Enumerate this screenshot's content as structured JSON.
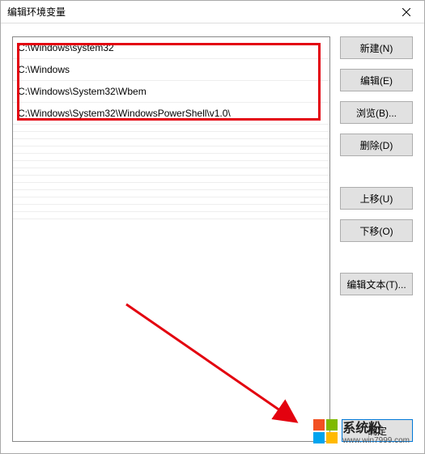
{
  "dialog": {
    "title": "编辑环境变量"
  },
  "paths": [
    "C:\\Windows\\system32",
    "C:\\Windows",
    "C:\\Windows\\System32\\Wbem",
    "C:\\Windows\\System32\\WindowsPowerShell\\v1.0\\"
  ],
  "buttons": {
    "new": "新建(N)",
    "edit": "编辑(E)",
    "browse": "浏览(B)...",
    "delete": "删除(D)",
    "move_up": "上移(U)",
    "move_down": "下移(O)",
    "edit_text": "编辑文本(T)...",
    "ok": "确定"
  },
  "watermark": {
    "brand": "系统粉",
    "url": "www.win7999.com"
  }
}
